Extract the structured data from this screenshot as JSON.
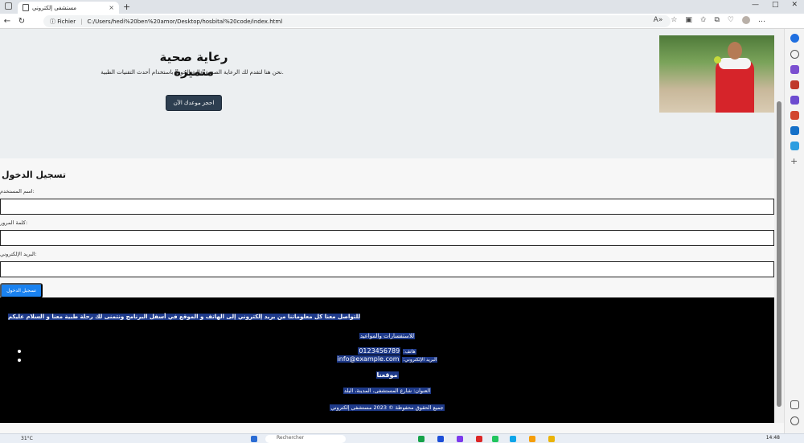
{
  "browser": {
    "tab_title": "مستشفى إلكتروني",
    "tab_close": "×",
    "new_tab": "+",
    "url_label": "Fichier",
    "url": "C:/Users/hedi%20ben%20amor/Desktop/hosbital%20code/index.html",
    "win_min": "—",
    "win_max": "□",
    "win_close": "✕"
  },
  "hero": {
    "title": "رعاية صحية متميزة",
    "subtitle": ".نحن هنا لتقدم لك الرعاية الصحية عالية الجودة باستخدام أحدث التقنيات الطبية",
    "cta_label": "احجز موعدك الآن"
  },
  "login": {
    "title": "تسجيل الدخول",
    "username_label": ":اسم المستخدم",
    "password_label": ":كلمة المرور",
    "email_label": ":البريد الإلكتروني",
    "submit_label": "تسجيل الدخول"
  },
  "footer": {
    "intro": "للتواصل معنا كل معلوماتنا من بريد إلكتروني إلى الهاتف و الموقع في أسفل البرنامج ونتمنى لك رحلة طبية معنا و السلام عليكم",
    "heading": "للاستفسارات والمواعيد",
    "phone_label": "هاتف:",
    "phone": "0123456789",
    "email_label": "البريد الإلكتروني:",
    "email": "info@example.com",
    "location_title": "موقعنا",
    "address": "العنوان: شارع المستشفى، المدينة، البلد",
    "copyright": "جميع الحقوق محفوظة © 2023 مستشفى إلكتروني"
  },
  "taskbar": {
    "weather": "31°C",
    "search_placeholder": "Rechercher",
    "time": "14:48"
  },
  "colors": {
    "accent_blue": "#1a82f0",
    "hero_button": "#2d3e50",
    "footer_bg": "#000000",
    "text_highlight": "#1e3a8a"
  }
}
